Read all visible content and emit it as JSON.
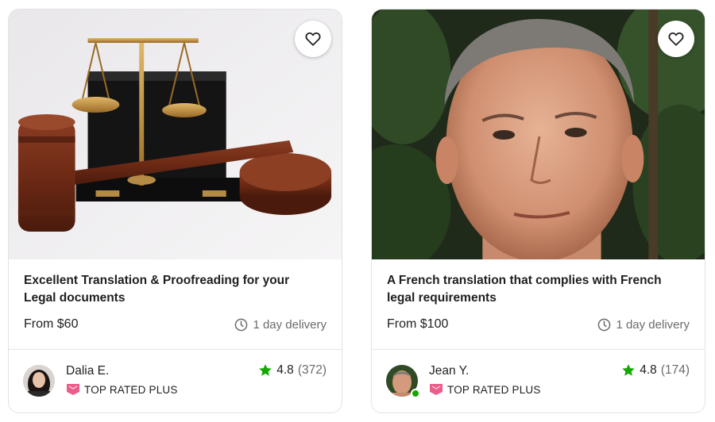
{
  "cards": [
    {
      "title": "Excellent Translation & Proofreading for your Legal documents",
      "price": "From $60",
      "delivery": "1 day delivery",
      "seller_name": "Dalia E.",
      "badge": "TOP RATED PLUS",
      "rating": "4.8",
      "reviews": "(372)",
      "online": false
    },
    {
      "title": "A French translation that complies with French legal requirements",
      "price": "From $100",
      "delivery": "1 day delivery",
      "seller_name": "Jean Y.",
      "badge": "TOP RATED PLUS",
      "rating": "4.8",
      "reviews": "(174)",
      "online": true
    }
  ],
  "colors": {
    "star": "#14a800",
    "badge": "#ec5d89",
    "online": "#14a800"
  },
  "icons": [
    "heart-icon",
    "clock-icon",
    "star-icon",
    "top-rated-badge-icon"
  ]
}
